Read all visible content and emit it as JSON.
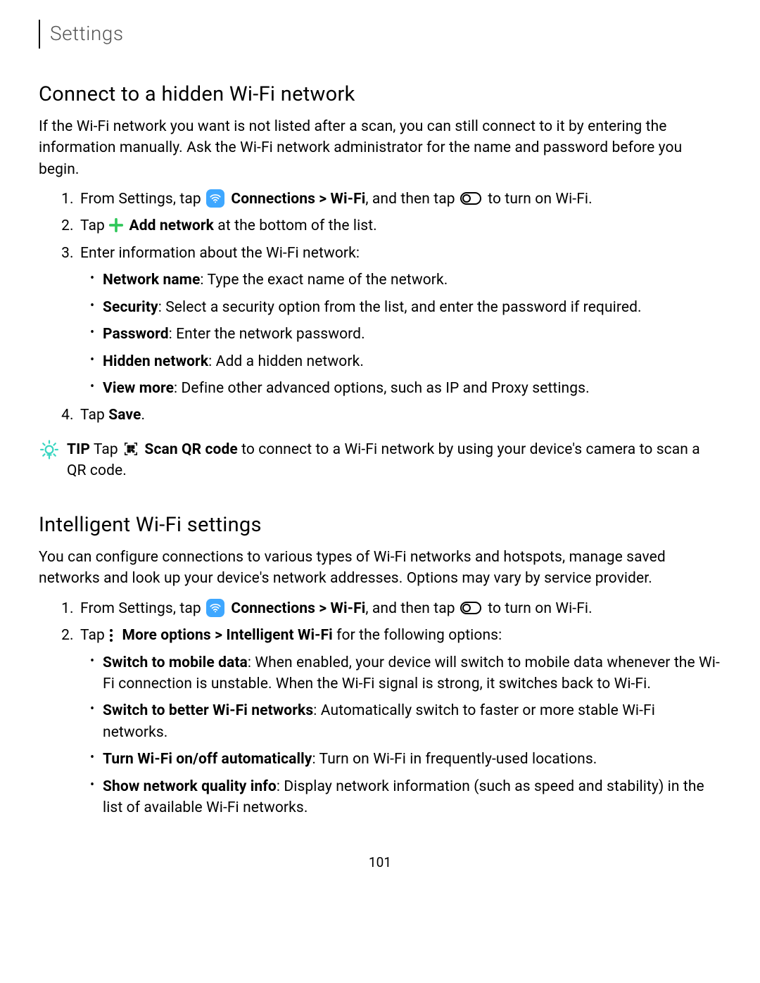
{
  "header": "Settings",
  "section1": {
    "title": "Connect to a hidden Wi-Fi network",
    "intro": "If the Wi-Fi network you want is not listed after a scan, you can still connect to it by entering the information manually. Ask the Wi-Fi network administrator for the name and password before you begin.",
    "step1_a": "From Settings, tap ",
    "step1_b": "Connections > Wi-Fi",
    "step1_c": ", and then tap ",
    "step1_d": " to turn on Wi-Fi.",
    "step2_a": "Tap ",
    "step2_b": "Add network",
    "step2_c": " at the bottom of the list.",
    "step3": "Enter information about the Wi-Fi network:",
    "bul1_b": "Network name",
    "bul1_c": ": Type the exact name of the network.",
    "bul2_b": "Security",
    "bul2_c": ": Select a security option from the list, and enter the password if required.",
    "bul3_b": "Password",
    "bul3_c": ": Enter the network password.",
    "bul4_b": "Hidden network",
    "bul4_c": ": Add a hidden network.",
    "bul5_b": "View more",
    "bul5_c": ": Define other advanced options, such as IP and Proxy settings.",
    "step4_a": "Tap ",
    "step4_b": "Save",
    "step4_c": ".",
    "tip_label": "TIP",
    "tip_a": "  Tap ",
    "tip_b": "Scan QR code",
    "tip_c": " to connect to a Wi-Fi network by using your device's camera to scan a QR code."
  },
  "section2": {
    "title": "Intelligent Wi-Fi settings",
    "intro": "You can configure connections to various types of Wi-Fi networks and hotspots, manage saved networks and look up your device's network addresses. Options may vary by service provider.",
    "step1_a": "From Settings, tap ",
    "step1_b": "Connections > Wi-Fi",
    "step1_c": ", and then tap ",
    "step1_d": " to turn on Wi-Fi.",
    "step2_a": "Tap ",
    "step2_b": "More options > Intelligent Wi-Fi",
    "step2_c": " for the following options:",
    "bul1_b": "Switch to mobile data",
    "bul1_c": ": When enabled, your device will switch to mobile data whenever the Wi-Fi connection is unstable. When the Wi-Fi signal is strong, it switches back to Wi-Fi.",
    "bul2_b": "Switch to better Wi-Fi networks",
    "bul2_c": ": Automatically switch to faster or more stable Wi-Fi networks.",
    "bul3_b": "Turn Wi-Fi on/off automatically",
    "bul3_c": ": Turn on Wi-Fi in frequently-used locations.",
    "bul4_b": "Show network quality info",
    "bul4_c": ": Display network information (such as speed and stability) in the list of available Wi-Fi networks."
  },
  "page_number": "101"
}
